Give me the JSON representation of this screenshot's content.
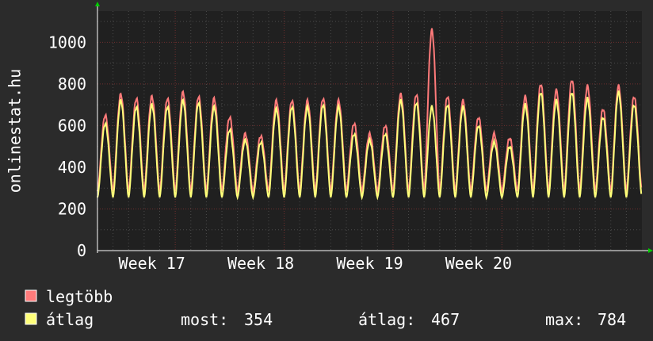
{
  "chart_data": {
    "type": "line",
    "ylabel": "onlinestat.hu",
    "ylim": [
      0,
      1150
    ],
    "y_ticks": [
      0,
      200,
      400,
      600,
      800,
      1000
    ],
    "x_ticks": [
      "Week 17",
      "Week 18",
      "Week 19",
      "Week 20"
    ],
    "grid": true,
    "colors": {
      "background": "#2b2b2b",
      "plot_background": "#202020",
      "major_grid": "#6e2e2e",
      "minor_grid": "#4a4a4a",
      "axis_arrow": "#00cc00"
    },
    "daily_peaks_avg": [
      610,
      720,
      690,
      700,
      690,
      720,
      710,
      690,
      580,
      530,
      520,
      680,
      690,
      690,
      700,
      690,
      560,
      530,
      560,
      720,
      710,
      690,
      700,
      690,
      600,
      520,
      500,
      700,
      760,
      720,
      760,
      730,
      640,
      760,
      700
    ],
    "daily_peaks_max": [
      650,
      750,
      730,
      740,
      730,
      760,
      740,
      730,
      640,
      560,
      550,
      720,
      720,
      720,
      730,
      720,
      610,
      560,
      600,
      750,
      750,
      1060,
      740,
      720,
      640,
      560,
      540,
      740,
      800,
      770,
      820,
      790,
      680,
      790,
      740
    ],
    "series": [
      {
        "name": "legtöbb",
        "color": "#ff7a7a"
      },
      {
        "name": "átlag",
        "color": "#ffff7a"
      }
    ],
    "stats": [
      {
        "label": "most:",
        "value": "354"
      },
      {
        "label": "átlag:",
        "value": "467"
      },
      {
        "label": "max:",
        "value": "784"
      }
    ]
  }
}
